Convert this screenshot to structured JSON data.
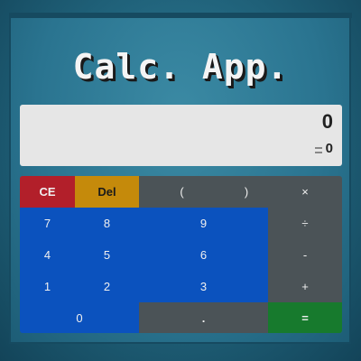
{
  "app": {
    "title": "Calc. App."
  },
  "display": {
    "expression": "0",
    "result": "0"
  },
  "keypad": {
    "ce": "CE",
    "del": "Del",
    "open_paren": "(",
    "close_paren": ")",
    "multiply": "×",
    "divide": "÷",
    "minus": "-",
    "plus": "+",
    "equals": "=",
    "dot": ".",
    "seven": "7",
    "eight": "8",
    "nine": "9",
    "four": "4",
    "five": "5",
    "six": "6",
    "one": "1",
    "two": "2",
    "three": "3",
    "zero": "0"
  },
  "colors": {
    "clear_key": "#b21f2a",
    "delete_key": "#c58a0b",
    "operator_key": "#4b5357",
    "digit_key": "#0b52be",
    "equals_key": "#177a2d",
    "display_bg": "#e6e6e6",
    "background": "#1f6078"
  },
  "icons": {
    "equals_indicator": "equals-icon"
  }
}
